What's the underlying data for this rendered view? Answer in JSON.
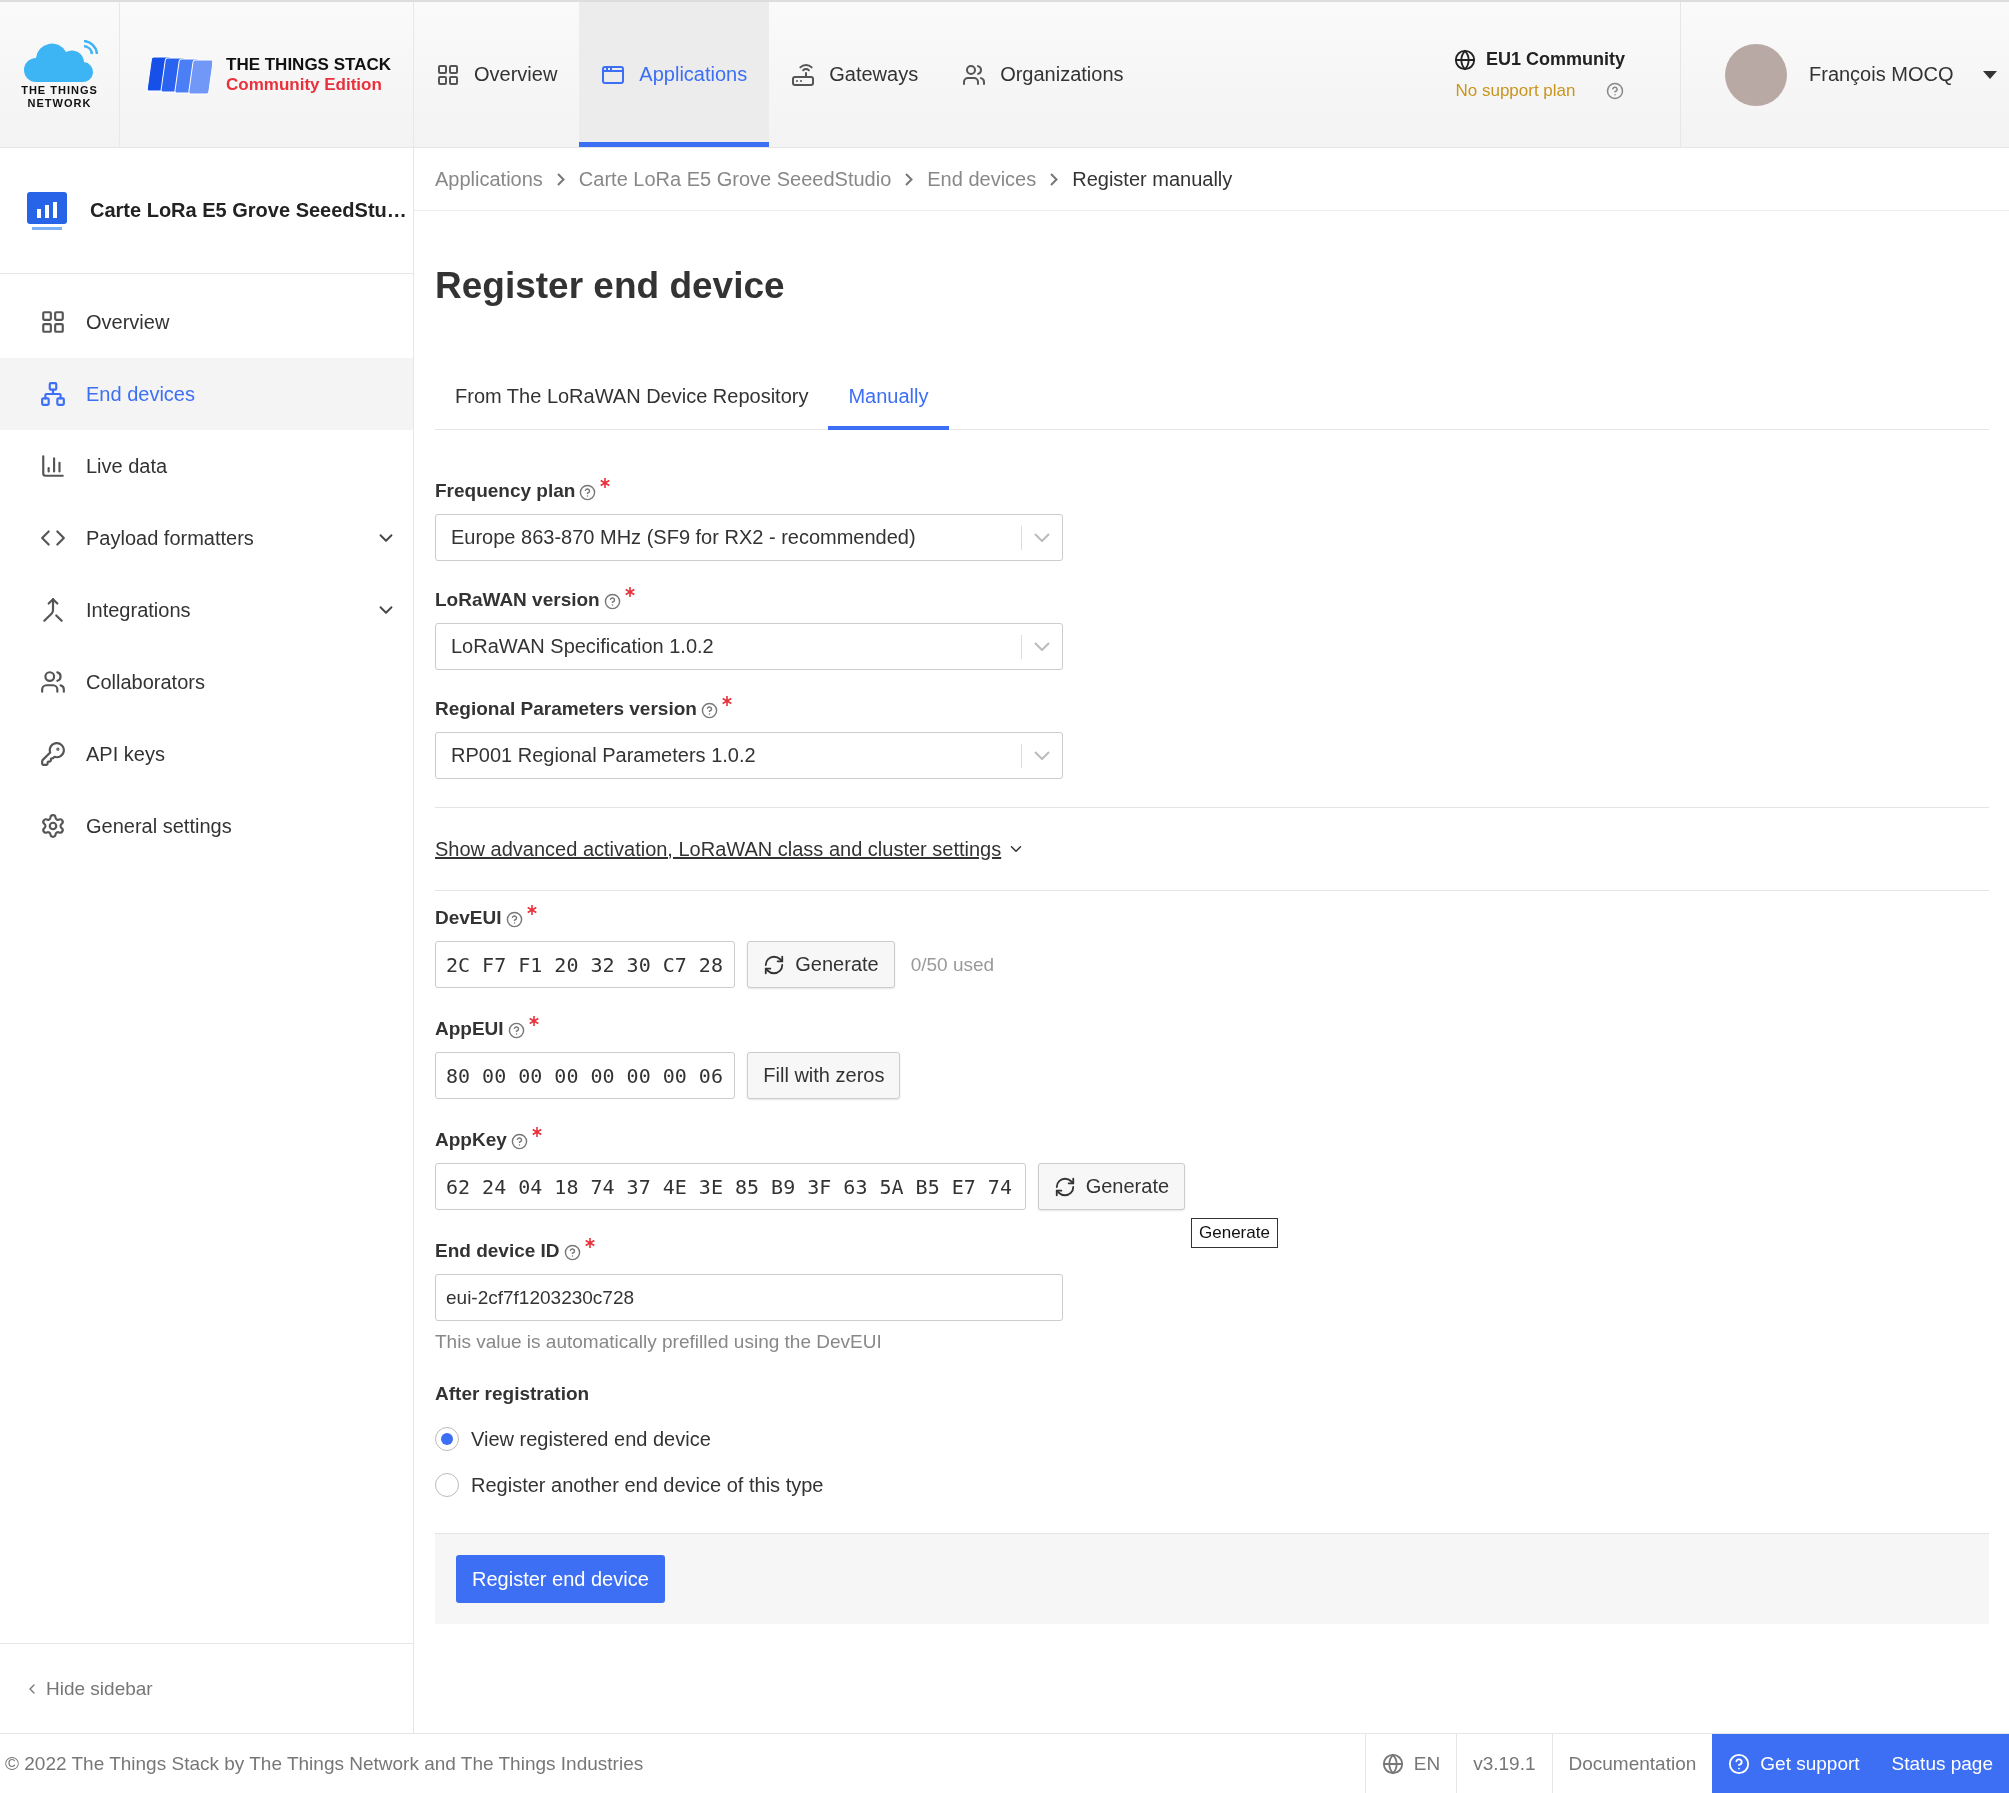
{
  "header": {
    "network_logo": [
      "THE THINGS",
      "NETWORK"
    ],
    "stack_title": "THE THINGS STACK",
    "stack_edition": "Community Edition",
    "nav": [
      {
        "label": "Overview",
        "selected": false
      },
      {
        "label": "Applications",
        "selected": true
      },
      {
        "label": "Gateways",
        "selected": false
      },
      {
        "label": "Organizations",
        "selected": false
      }
    ],
    "cluster": {
      "name": "EU1 Community",
      "plan": "No support plan"
    },
    "user": {
      "name": "François MOCQ"
    }
  },
  "sidebar": {
    "app_name": "Carte LoRa E5 Grove SeeedStu…",
    "items": [
      {
        "label": "Overview",
        "selected": false,
        "expandable": false
      },
      {
        "label": "End devices",
        "selected": true,
        "expandable": false
      },
      {
        "label": "Live data",
        "selected": false,
        "expandable": false
      },
      {
        "label": "Payload formatters",
        "selected": false,
        "expandable": true
      },
      {
        "label": "Integrations",
        "selected": false,
        "expandable": true
      },
      {
        "label": "Collaborators",
        "selected": false,
        "expandable": false
      },
      {
        "label": "API keys",
        "selected": false,
        "expandable": false
      },
      {
        "label": "General settings",
        "selected": false,
        "expandable": false
      }
    ],
    "hide_label": "Hide sidebar"
  },
  "breadcrumbs": [
    "Applications",
    "Carte LoRa E5 Grove SeeedStudio",
    "End devices",
    "Register manually"
  ],
  "title": "Register end device",
  "tabs": [
    {
      "label": "From The LoRaWAN Device Repository",
      "selected": false
    },
    {
      "label": "Manually",
      "selected": true
    }
  ],
  "form": {
    "selects": [
      {
        "label": "Frequency plan",
        "required": true,
        "value": "Europe 863-870 MHz (SF9 for RX2 - recommended)"
      },
      {
        "label": "LoRaWAN version",
        "required": true,
        "value": "LoRaWAN Specification 1.0.2"
      },
      {
        "label": "Regional Parameters version",
        "required": true,
        "value": "RP001 Regional Parameters 1.0.2"
      }
    ],
    "advanced_link": "Show advanced activation, LoRaWAN class and cluster settings",
    "keys": [
      {
        "kind": "generate",
        "label": "DevEUI",
        "required": true,
        "value": "2C F7 F1 20 32 30 C7 28",
        "button": "Generate",
        "note": "0/50 used"
      },
      {
        "kind": "fill",
        "label": "AppEUI",
        "required": true,
        "value": "80 00 00 00 00 00 00 06",
        "button": "Fill with zeros"
      },
      {
        "kind": "generate",
        "label": "AppKey",
        "required": true,
        "value": "62 24 04 18 74 37 4E 3E 85 B9 3F 63 5A B5 E7 74",
        "button": "Generate"
      }
    ],
    "device_id": {
      "label": "End device ID",
      "required": true,
      "value": "eui-2cf7f1203230c728",
      "hint": "This value is automatically prefilled using the DevEUI"
    },
    "after_registration": {
      "label": "After registration",
      "options": [
        {
          "label": "View registered end device",
          "selected": true
        },
        {
          "label": "Register another end device of this type",
          "selected": false
        }
      ]
    },
    "submit": "Register end device"
  },
  "tooltip": "Generate",
  "footer": {
    "copyright": "© 2022 The Things Stack by The Things Network and The Things Industries",
    "language": "EN",
    "version": "v3.19.1",
    "links": [
      {
        "label": "Documentation",
        "kind": "plain"
      },
      {
        "label": "Get support",
        "kind": "support"
      },
      {
        "label": "Status page",
        "kind": "status"
      }
    ]
  }
}
